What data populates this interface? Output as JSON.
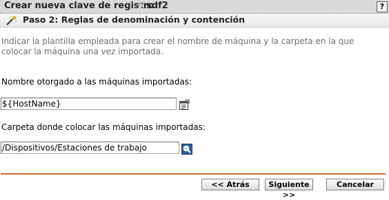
{
  "header": {
    "title": "Crear nueva clave de registro",
    "name": "sdf2",
    "help_label": "?"
  },
  "step": {
    "label": "Paso 2: Reglas de denominación y contención",
    "icon": "wand-icon"
  },
  "description": "Indicar la plantilla empleada para crear el nombre de máquina y la carpeta en la que colocar la máquina una vez importada.",
  "naming": {
    "label": "Nombre otorgado a las máquinas importadas:",
    "value": "${HostName}",
    "icon": "variable-picker-icon"
  },
  "folder": {
    "label": "Carpeta donde colocar las máquinas importadas:",
    "value": "/Dispositivos/Estaciones de trabajo",
    "icon": "browse-search-icon"
  },
  "buttons": {
    "back": "<< Atrás",
    "next": "Siguiente >>",
    "cancel": "Cancelar"
  },
  "colors": {
    "divider": "#c8692a",
    "title_bar": "#d9d9d9"
  }
}
